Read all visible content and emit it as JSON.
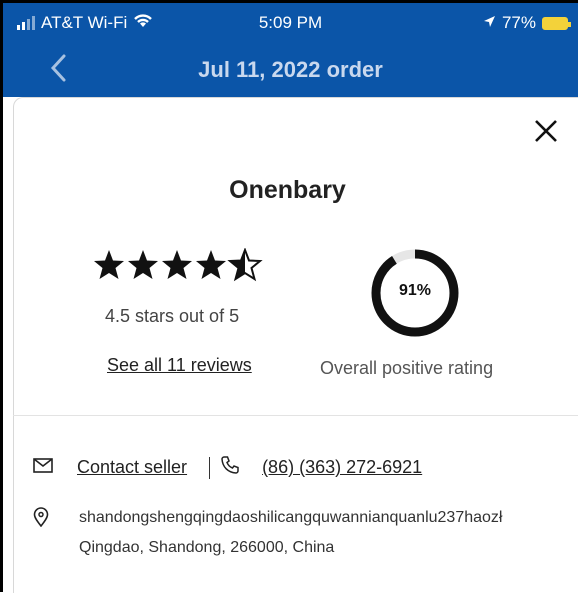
{
  "status_bar": {
    "carrier": "AT&T Wi-Fi",
    "time": "5:09 PM",
    "battery": "77%"
  },
  "nav": {
    "title": "Jul 11, 2022 order"
  },
  "store": {
    "name": "Onenbary",
    "stars_value": 4.5,
    "stars_text": "4.5 stars out of 5",
    "reviews_link": "See all 11 reviews",
    "positive_rating": "91%",
    "positive_rating_value": 0.91,
    "positive_rating_label": "Overall positive rating"
  },
  "contact": {
    "contact_label": "Contact seller",
    "phone": "(86) (363) 272-6921",
    "address_line1": "shandongshengqingdaoshilicangquwannianquanlu237haozł",
    "address_line2": "Qingdao, Shandong, 266000, China"
  },
  "colors": {
    "nav_bg": "#0b55a8",
    "accent_ring": "#111111",
    "ring_track": "#e6e6e6"
  }
}
